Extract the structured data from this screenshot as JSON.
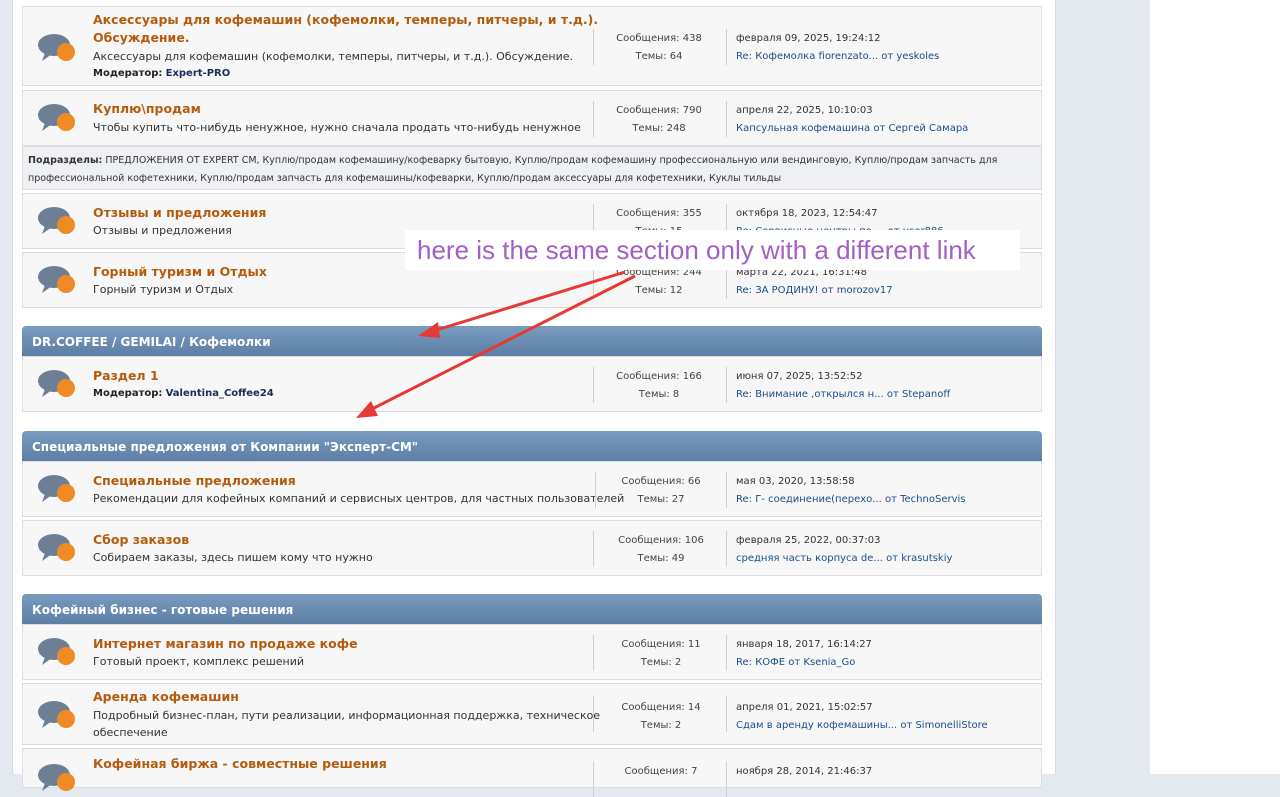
{
  "boards_top": [
    {
      "title_lines": [
        "Аксессуары для кофемашин (кофемолки, темперы, питчеры, и т.д.).",
        "Обсуждение."
      ],
      "description": "Аксессуары для кофемашин (кофемолки, темперы, питчеры, и т.д.). Обсуждение.",
      "moderator_label": "Модератор:",
      "moderator": "Expert-PRO",
      "posts": "Сообщения: 438",
      "topics": "Темы: 64",
      "last_date": "февраля 09, 2025, 19:24:12",
      "last_post": "Re: Кофемолка fiorenzato... от yeskoles"
    },
    {
      "title": "Куплю\\продам",
      "description": "Чтобы купить что-нибудь ненужное, нужно сначала продать что-нибудь ненужное",
      "posts": "Сообщения: 790",
      "topics": "Темы: 248",
      "last_date": "апреля 22, 2025, 10:10:03",
      "last_post": "Капсульная кофемашина от Сергей Самара"
    }
  ],
  "subforums": {
    "label": "Подразделы:",
    "text": "ПРЕДЛОЖЕНИЯ ОТ EXPERT CM, Куплю/продам кофемашину/кофеварку бытовую, Куплю/продам кофемашину профессиональную или вендинговую, Куплю/продам запчасть для профессиональной кофетехники, Куплю/продам запчасть для кофемашины/кофеварки, Куплю/продам аксессуары для кофетехники, Куклы тильды"
  },
  "boards_mid": [
    {
      "title": "Отзывы и предложения",
      "description": "Отзывы и предложения",
      "posts": "Сообщения: 355",
      "topics": "Темы: 15",
      "last_date": "октября 18, 2023, 12:54:47",
      "last_post": "Re: Сервисные центры по ... от user886"
    },
    {
      "title": "Горный туризм и Отдых",
      "description": "Горный туризм и Отдых",
      "posts": "Сообщения: 244",
      "topics": "Темы: 12",
      "last_date": "марта 22, 2021, 16:31:48",
      "last_post": "Re: ЗА РОДИНУ! от morozov17"
    }
  ],
  "categories": [
    {
      "header": "DR.COFFEE / GEMILAI / Кофемолки",
      "boards": [
        {
          "title": "Раздел 1",
          "moderator_label": "Модератор:",
          "moderator": "Valentina_Coffee24",
          "posts": "Сообщения: 166",
          "topics": "Темы: 8",
          "last_date": "июня 07, 2025, 13:52:52",
          "last_post": "Re: Внимание ,открылся н... от Stepanoff"
        }
      ]
    },
    {
      "header": "Специальные предложения от Компании \"Эксперт-СМ\"",
      "boards": [
        {
          "title": "Специальные предложения",
          "description": "Рекомендации для кофейных компаний и сервисных центров, для частных пользователей",
          "posts": "Сообщения: 66",
          "topics": "Темы: 27",
          "last_date": "мая 03, 2020, 13:58:58",
          "last_post": "Re: Г- соединение(перехо... от TechnoServis"
        },
        {
          "title": "Сбор заказов",
          "description": "Собираем заказы, здесь пишем кому что нужно",
          "posts": "Сообщения: 106",
          "topics": "Темы: 49",
          "last_date": "февраля 25, 2022, 00:37:03",
          "last_post": "средняя часть корпуса de... от krasutskiy"
        }
      ]
    },
    {
      "header": "Кофейный бизнес - готовые решения",
      "boards": [
        {
          "title": "Интернет магазин по продаже кофе",
          "description": "Готовый проект, комплекс решений",
          "posts": "Сообщения: 11",
          "topics": "Темы: 2",
          "last_date": "января 18, 2017, 16:14:27",
          "last_post": "Re: КОФЕ от Ksenia_Go"
        },
        {
          "title": "Аренда кофемашин",
          "description_lines": [
            "Подробный бизнес-план, пути реализации, информационная поддержка, техническое",
            "обеспечение"
          ],
          "posts": "Сообщения: 14",
          "topics": "Темы: 2",
          "last_date": "апреля 01, 2021, 15:02:57",
          "last_post": "Сдам в аренду кофемашины... от SimonelliStore"
        },
        {
          "title": "Кофейная биржа - совместные решения",
          "posts": "Сообщения: 7",
          "last_date": "ноября 28, 2014, 21:46:37"
        }
      ]
    }
  ],
  "annotation": {
    "text": "here is the same section only with a different link",
    "color": "#a260c2",
    "arrow_color": "#e53935"
  },
  "icons": {
    "board": "forum-speech-bubbles-icon"
  }
}
